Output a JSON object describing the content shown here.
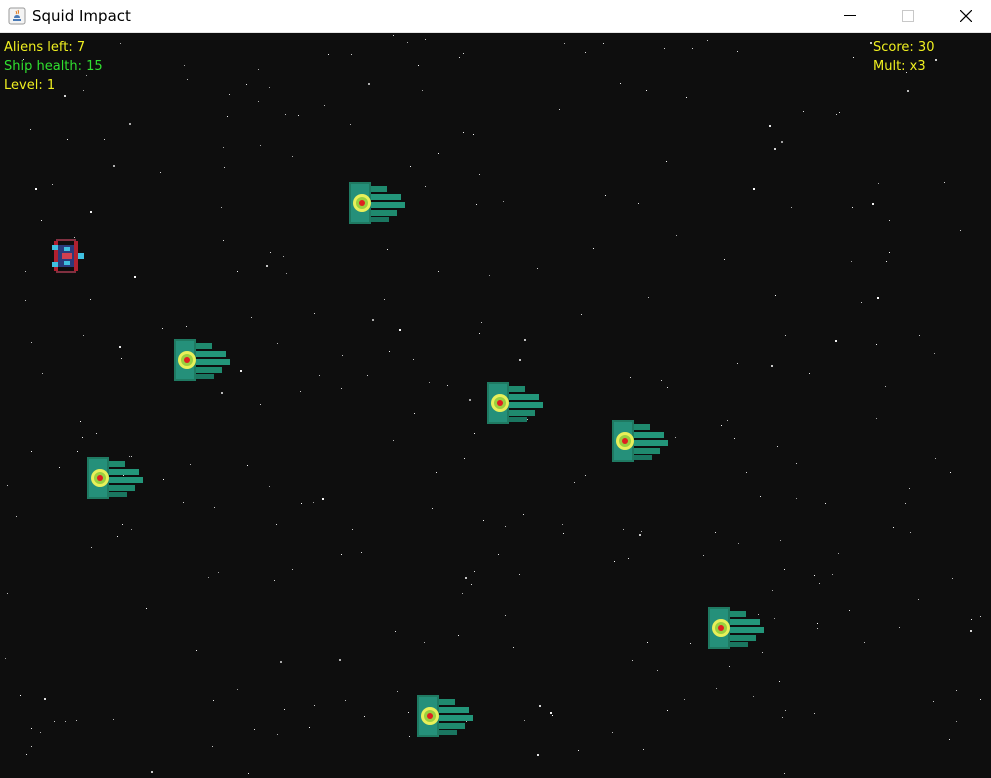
{
  "window": {
    "title": "Squid Impact"
  },
  "hud": {
    "aliens_left": "Aliens left: 7",
    "ship_health": "Ship health: 15",
    "level": "Level: 1",
    "score": "Score: 30",
    "multiplier": "Mult: x3"
  },
  "colors": {
    "hud_yellow": "#f0f020",
    "hud_green": "#30e030",
    "space": "#0e0e0e",
    "alien_teal": "#1f8a6e",
    "alien_eye": "#e8f05a"
  },
  "aliens_count_on_screen": 7
}
